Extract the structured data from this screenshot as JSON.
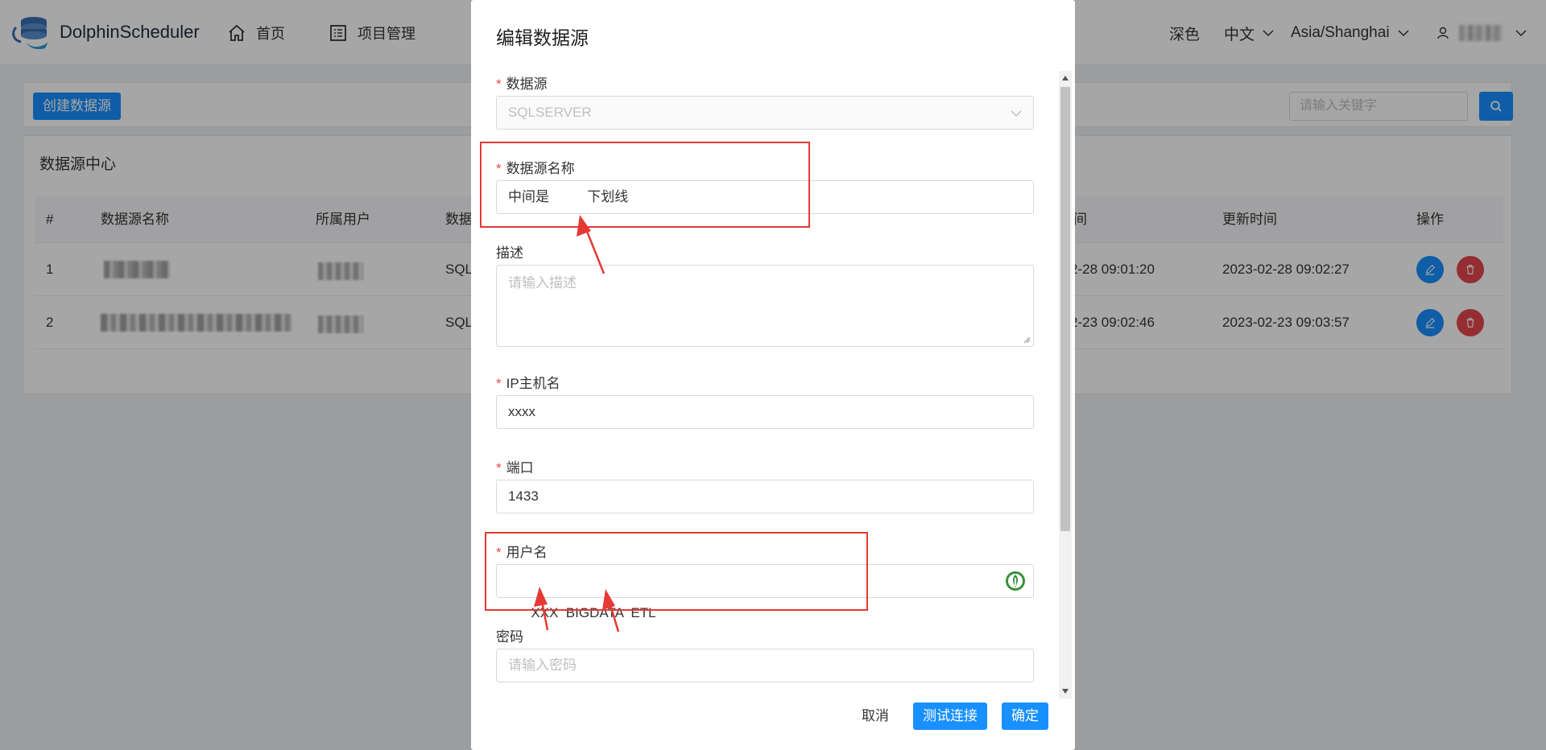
{
  "app": {
    "name": "DolphinScheduler"
  },
  "nav": {
    "items": [
      {
        "label": "首页",
        "icon": "home-icon"
      },
      {
        "label": "项目管理",
        "icon": "list-icon"
      }
    ]
  },
  "header_right": {
    "theme": "深色",
    "language": "中文",
    "timezone": "Asia/Shanghai",
    "user_icon": "user-icon"
  },
  "toolbar": {
    "create_label": "创建数据源",
    "search_placeholder": "请输入关键字"
  },
  "panel": {
    "title": "数据源中心",
    "columns": [
      "#",
      "数据源名称",
      "所属用户",
      "数据",
      "间",
      "更新时间",
      "操作"
    ],
    "rows": [
      {
        "index": "1",
        "type": "SQL",
        "create_time": "2-28 09:01:20",
        "update_time": "2023-02-28 09:02:27"
      },
      {
        "index": "2",
        "type": "SQL",
        "create_time": "2-23 09:02:46",
        "update_time": "2023-02-23 09:03:57"
      }
    ]
  },
  "modal": {
    "title": "编辑数据源",
    "fields": {
      "datasource": {
        "label": "数据源",
        "value": "SQLSERVER",
        "required": true
      },
      "name": {
        "label": "数据源名称",
        "value": "中间是          下划线",
        "required": true
      },
      "description": {
        "label": "描述",
        "placeholder": "请输入描述",
        "required": false
      },
      "host": {
        "label": "IP主机名",
        "value": "xxxx",
        "required": true
      },
      "port": {
        "label": "端口",
        "value": "1433",
        "required": true
      },
      "username": {
        "label": "用户名",
        "value": "XXX  BIGDATA  ETL",
        "required": true
      },
      "password": {
        "label": "密码",
        "placeholder": "请输入密码",
        "required": false
      }
    },
    "buttons": {
      "cancel": "取消",
      "test": "测试连接",
      "ok": "确定"
    }
  },
  "colors": {
    "primary": "#1890ff",
    "danger": "#e5484d",
    "annotation": "#e53935"
  }
}
